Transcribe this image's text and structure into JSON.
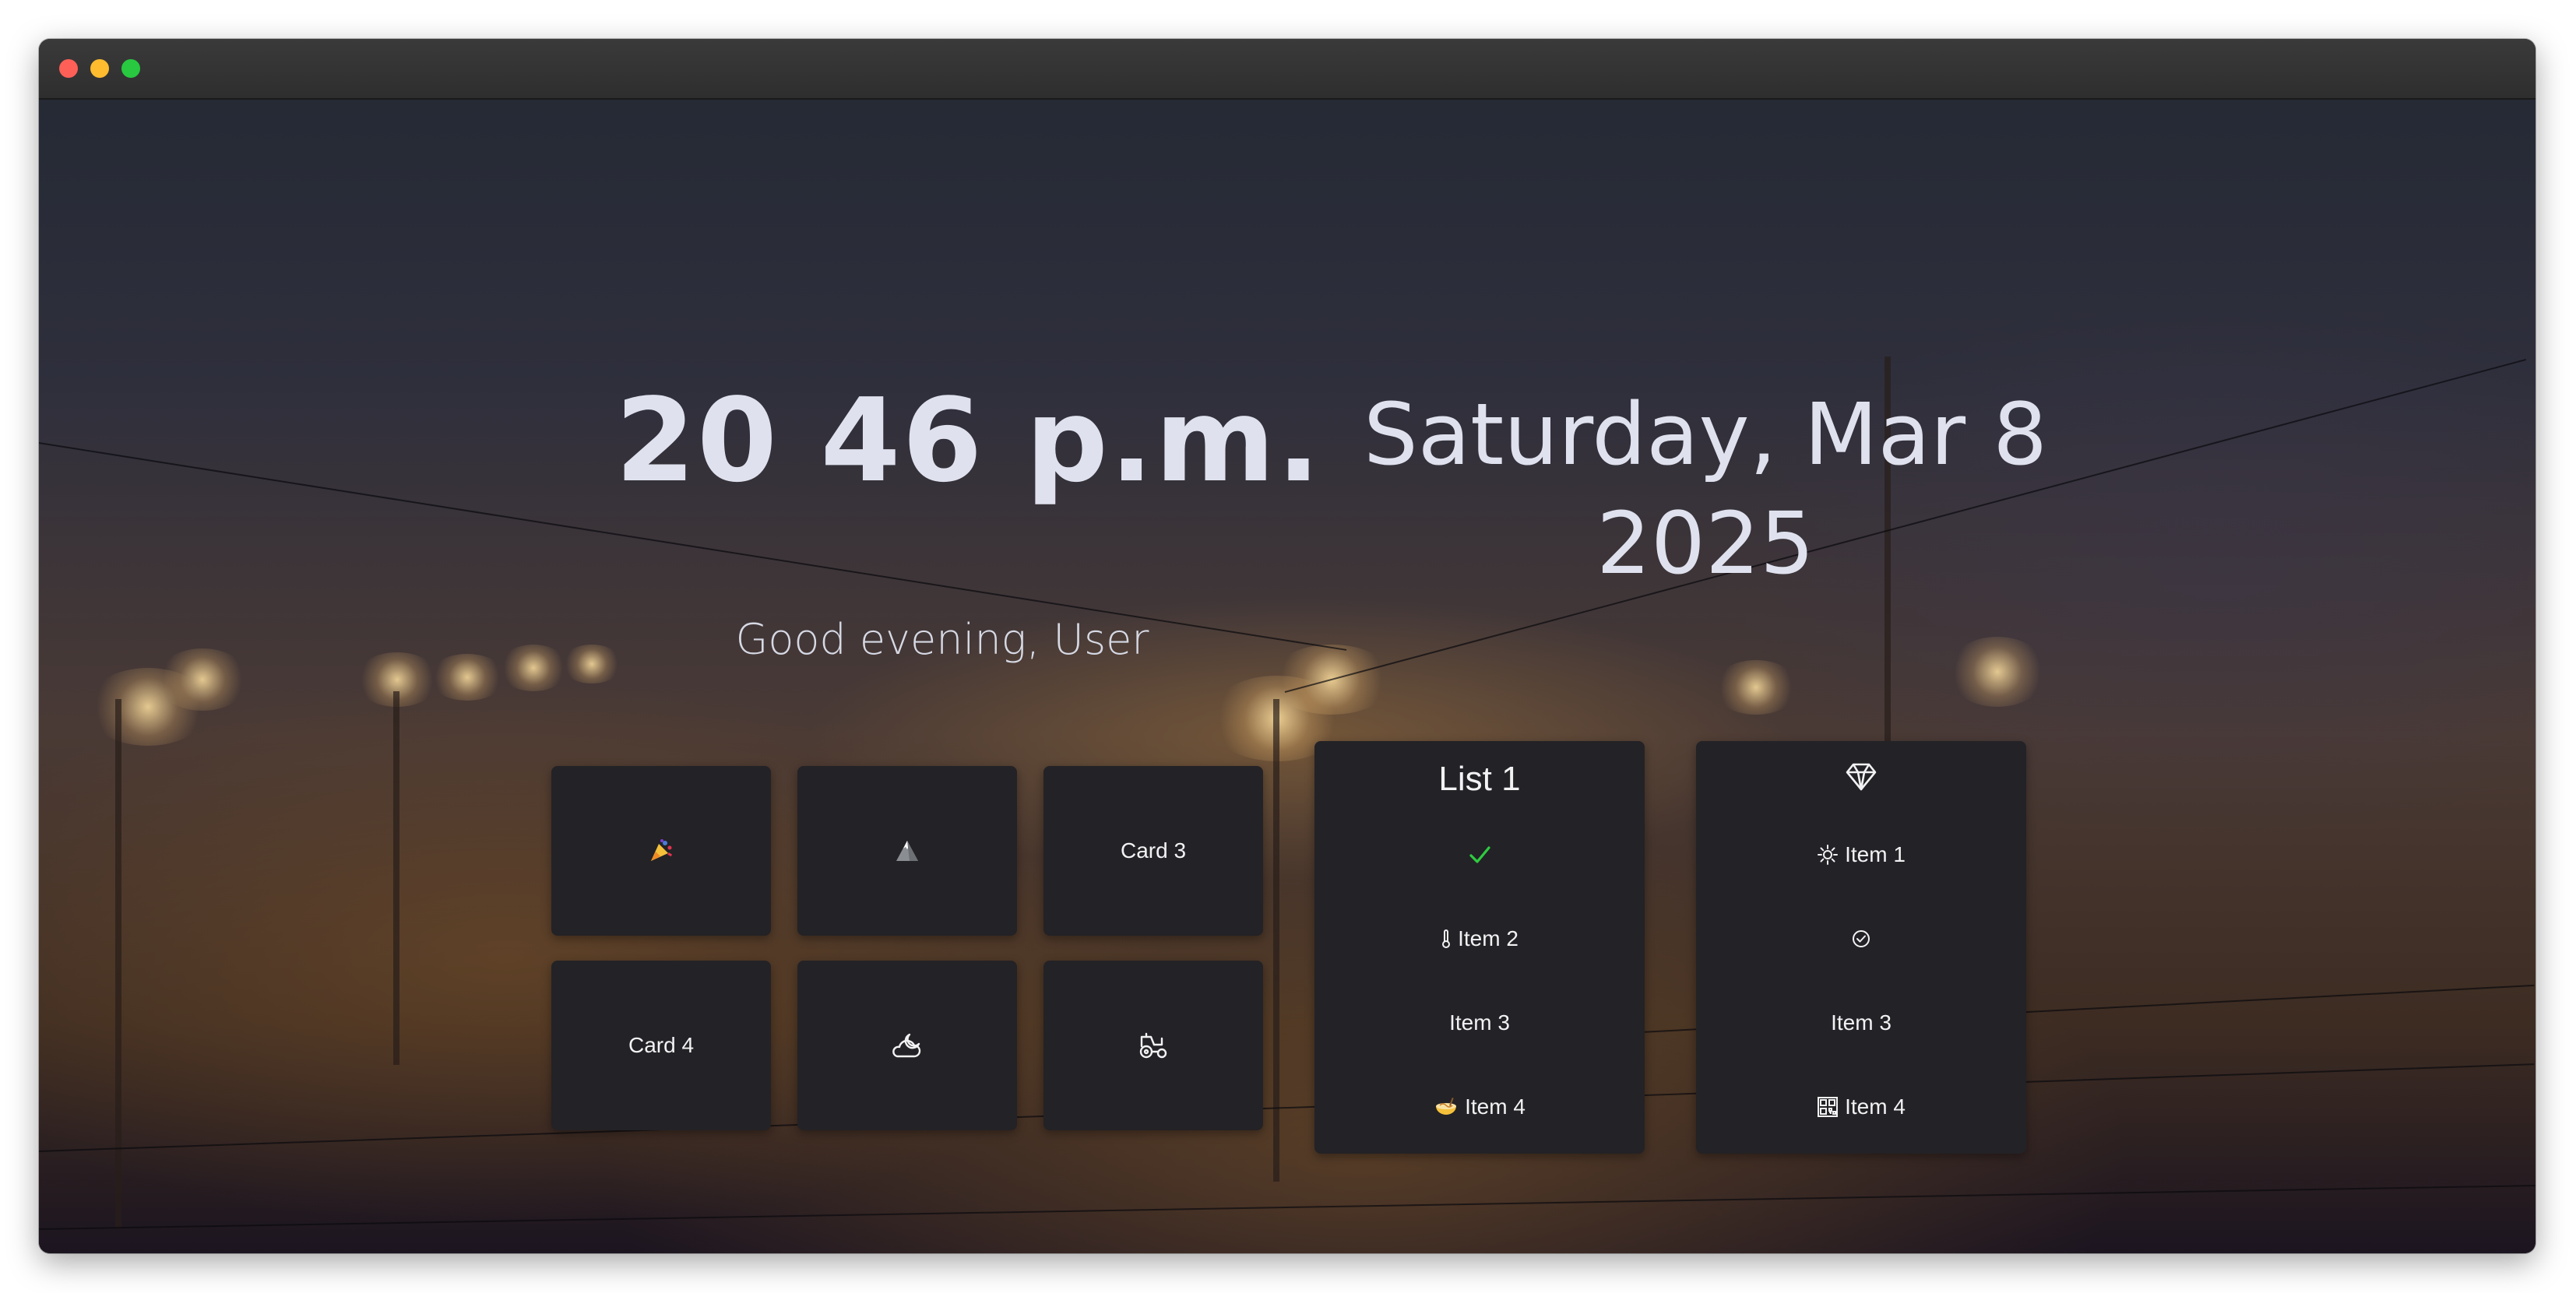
{
  "clock": {
    "time": "20 46 p.m."
  },
  "date": {
    "line1": "Saturday, Mar 8",
    "line2": "2025"
  },
  "greeting": {
    "text": "Good evening, User"
  },
  "cards": [
    {
      "icon": "party-popper-icon",
      "label": ""
    },
    {
      "icon": "mountain-icon",
      "label": ""
    },
    {
      "icon": "",
      "label": "Card 3"
    },
    {
      "icon": "",
      "label": "Card 4"
    },
    {
      "icon": "cloud-moon-icon",
      "label": ""
    },
    {
      "icon": "tractor-icon",
      "label": ""
    }
  ],
  "list1": {
    "title": "List 1",
    "items": [
      {
        "icon": "checkmark-icon",
        "label": ""
      },
      {
        "icon": "thermometer-icon",
        "label": "Item 2"
      },
      {
        "icon": "",
        "label": "Item 3"
      },
      {
        "icon": "noodle-bowl-icon",
        "label": "Item 4"
      }
    ]
  },
  "list2": {
    "header_icon": "diamond-icon",
    "items": [
      {
        "icon": "sun-icon",
        "label": "Item 1"
      },
      {
        "icon": "check-circle-icon",
        "label": ""
      },
      {
        "icon": "",
        "label": "Item 3"
      },
      {
        "icon": "qr-code-icon",
        "label": "Item 4"
      }
    ]
  },
  "colors": {
    "text": "#dfe2ee",
    "card_bg": "#232226",
    "check_green": "#2ecc40"
  }
}
